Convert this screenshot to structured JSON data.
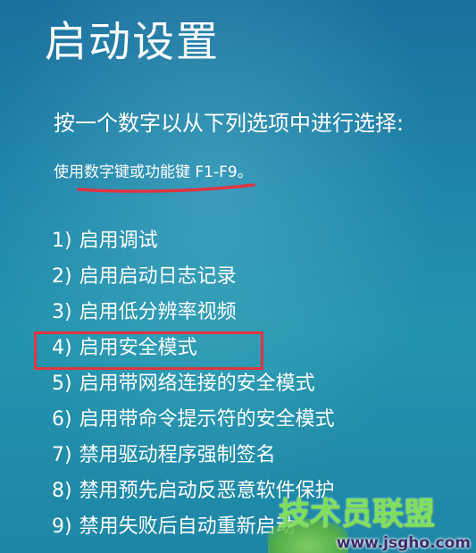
{
  "screen": {
    "title": "启动设置",
    "prompt": "按一个数字以从下列选项中进行选择:",
    "hint": "使用数字键或功能键 F1-F9。",
    "annotation_color": "#e2343f",
    "options": [
      {
        "num": "1)",
        "label": "启用调试"
      },
      {
        "num": "2)",
        "label": "启用启动日志记录"
      },
      {
        "num": "3)",
        "label": "启用低分辨率视频"
      },
      {
        "num": "4)",
        "label": "启用安全模式"
      },
      {
        "num": "5)",
        "label": "启用带网络连接的安全模式"
      },
      {
        "num": "6)",
        "label": "启用带命令提示符的安全模式"
      },
      {
        "num": "7)",
        "label": "禁用驱动程序强制签名"
      },
      {
        "num": "8)",
        "label": "禁用预先启动反恶意软件保护"
      },
      {
        "num": "9)",
        "label": "禁用失败后自动重新启动"
      }
    ],
    "highlighted_option": "4)"
  },
  "watermark": {
    "title": "技术员联盟",
    "url": "www.jsgho.com"
  }
}
